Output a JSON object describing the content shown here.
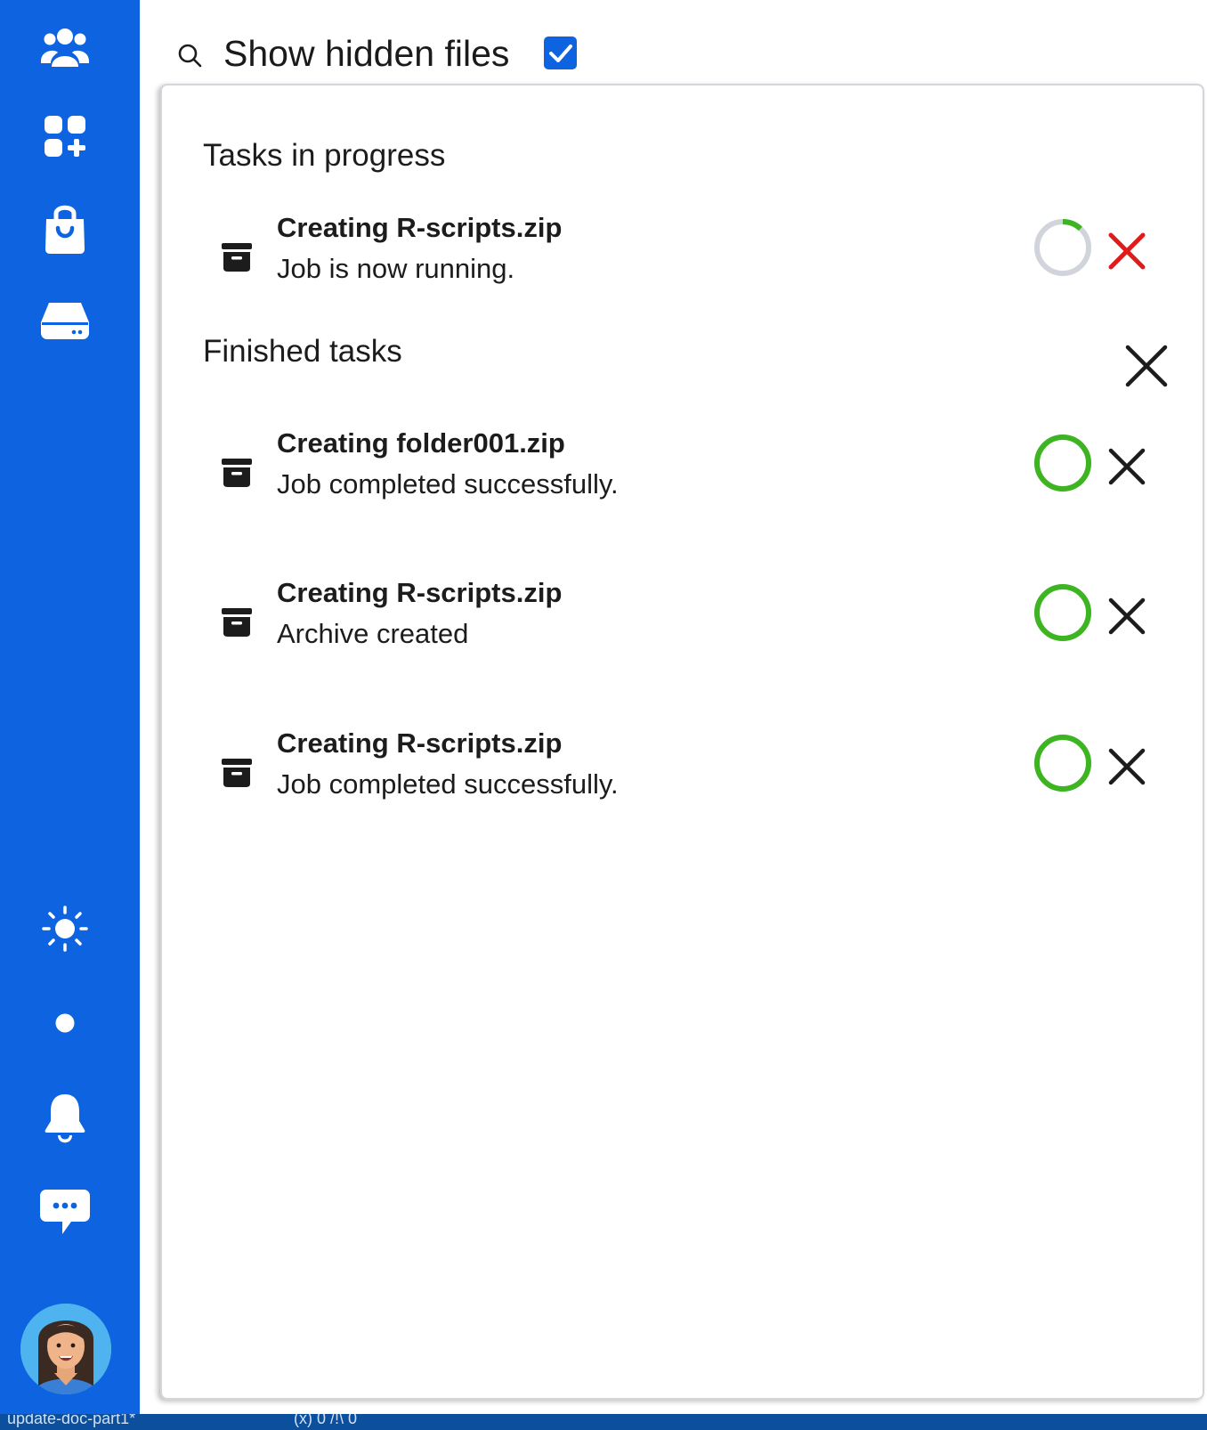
{
  "sidebar": {
    "items": [
      {
        "icon": "people-icon"
      },
      {
        "icon": "apps-add-icon"
      },
      {
        "icon": "shopping-bag-icon"
      },
      {
        "icon": "drive-icon"
      }
    ],
    "bottom_items": [
      {
        "icon": "sun-icon"
      },
      {
        "icon": "dot-icon"
      },
      {
        "icon": "bell-icon"
      },
      {
        "icon": "chat-icon"
      }
    ],
    "accent_color": "#0d63e0"
  },
  "header": {
    "show_hidden_label": "Show hidden files",
    "show_hidden_checked": true
  },
  "tasks": {
    "in_progress_title": "Tasks in progress",
    "finished_title": "Finished tasks",
    "in_progress": [
      {
        "name": "Creating R-scripts.zip",
        "status": "Job is now running.",
        "progress": 0.12
      }
    ],
    "finished": [
      {
        "name": "Creating folder001.zip",
        "status": "Job completed successfully.",
        "progress": 1
      },
      {
        "name": "Creating R-scripts.zip",
        "status": "Archive created",
        "progress": 1
      },
      {
        "name": "Creating R-scripts.zip",
        "status": "Job completed successfully.",
        "progress": 1
      }
    ],
    "colors": {
      "success": "#3cb521",
      "cancel": "#e01b1b",
      "track": "#d1d5db"
    }
  },
  "statusbar": {
    "branch": "update-doc-part1*",
    "problems": "(x) 0 /!\\ 0"
  }
}
